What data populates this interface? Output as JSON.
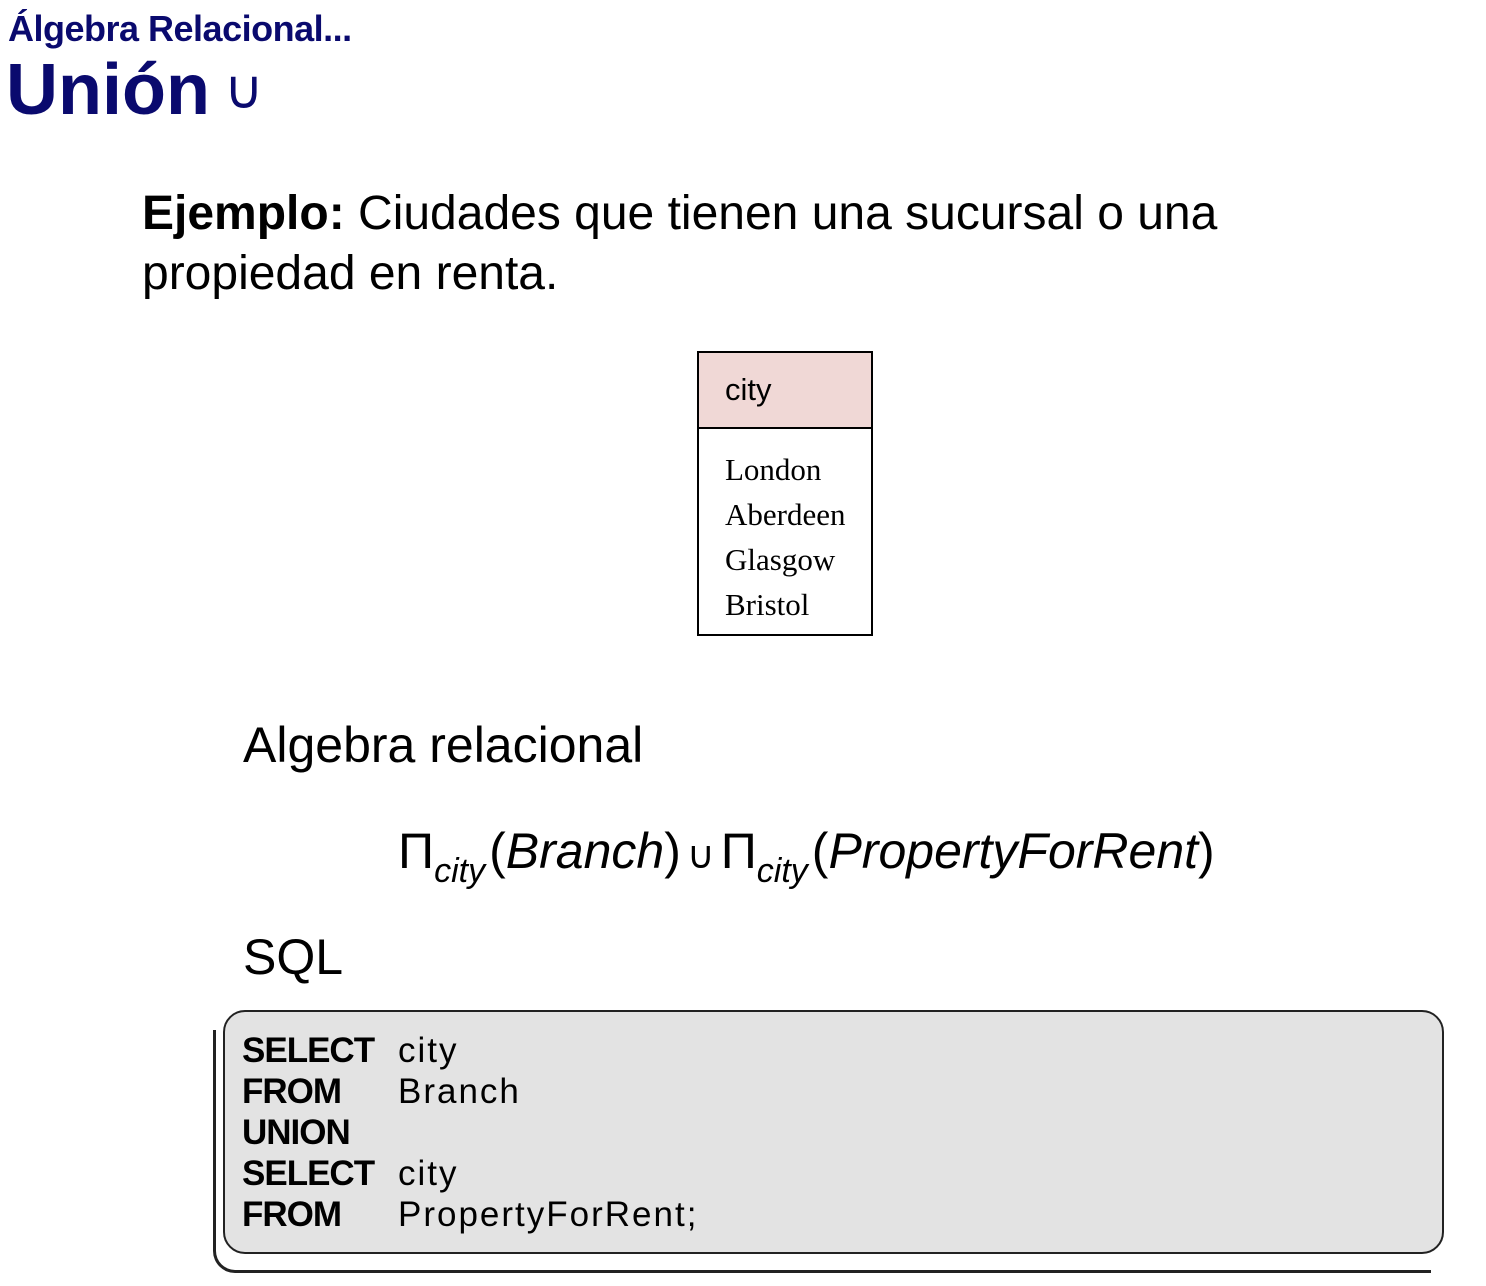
{
  "header": {
    "subtitle": "Álgebra Relacional...",
    "title": "Unión",
    "title_symbol": "∪"
  },
  "example": {
    "label": "Ejemplo:",
    "text": " Ciudades que tienen una sucursal o una propiedad en renta."
  },
  "result_table": {
    "column": "city",
    "rows": [
      "London",
      "Aberdeen",
      "Glasgow",
      "Bristol"
    ]
  },
  "algebra": {
    "heading": "Algebra relacional",
    "formula": {
      "pi1": "Π",
      "sub1": "city",
      "open1": "(",
      "rel1": "Branch",
      "close1": ")",
      "op": "∪",
      "pi2": "Π",
      "sub2": "city",
      "open2": "(",
      "rel2": "PropertyForRent",
      "close2": ")"
    }
  },
  "sql": {
    "heading": "SQL",
    "lines": [
      {
        "keyword": "SELECT",
        "value": "city"
      },
      {
        "keyword": "FROM",
        "value": "Branch"
      },
      {
        "keyword": "UNION",
        "value": ""
      },
      {
        "keyword": "SELECT",
        "value": "city"
      },
      {
        "keyword": "FROM",
        "value": "PropertyForRent;"
      }
    ]
  },
  "colors": {
    "title": "#0a0a6e",
    "table_header_bg": "#f0d8d6",
    "sql_box_bg": "#e3e3e3"
  }
}
